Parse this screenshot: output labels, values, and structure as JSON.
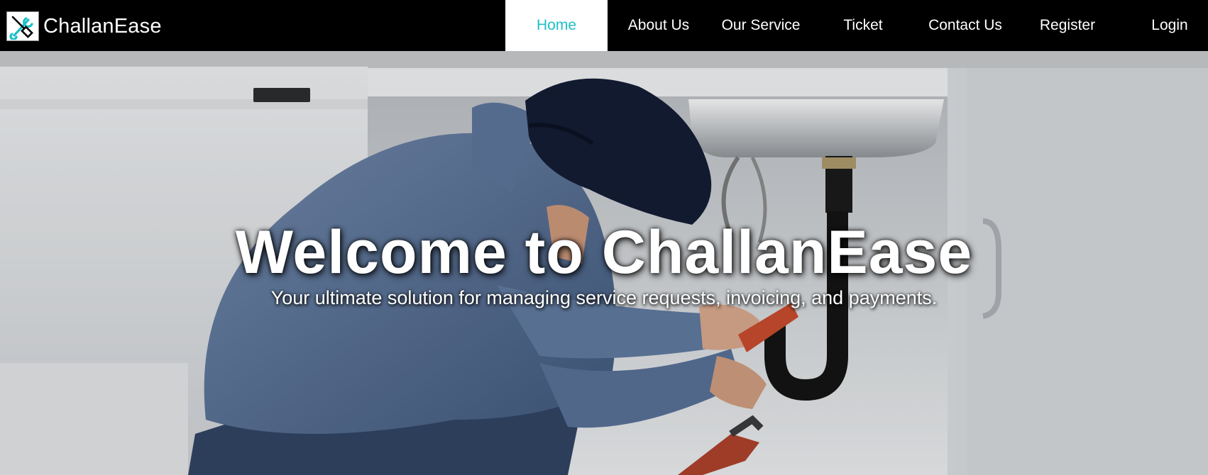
{
  "brand": {
    "name": "ChallanEase",
    "logo_icon": "wrench-screwdriver-icon"
  },
  "nav": {
    "items": [
      {
        "label": "Home",
        "active": true
      },
      {
        "label": "About Us",
        "active": false
      },
      {
        "label": "Our Service",
        "active": false
      },
      {
        "label": "Ticket",
        "active": false
      },
      {
        "label": "Contact Us",
        "active": false
      },
      {
        "label": "Register",
        "active": false
      },
      {
        "label": "Login",
        "active": false
      }
    ]
  },
  "hero": {
    "title": "Welcome to ChallanEase",
    "subtitle": "Your ultimate solution for managing service requests, invoicing, and payments.",
    "background": "plumber-under-sink-photo"
  },
  "colors": {
    "accent": "#1cc1c8",
    "navbar_bg": "#000000",
    "nav_text": "#ffffff"
  }
}
